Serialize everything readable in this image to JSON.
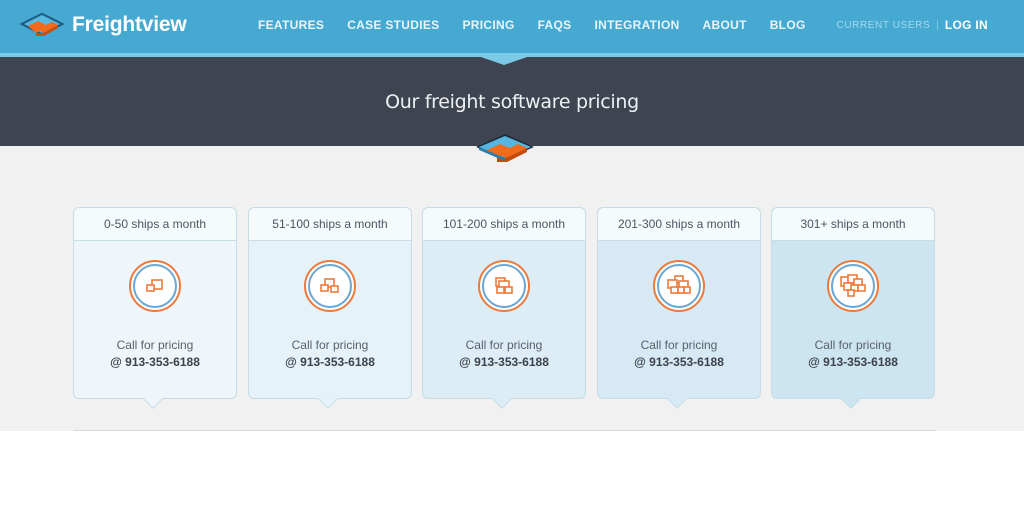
{
  "header": {
    "brand": "Freightview",
    "nav": [
      "FEATURES",
      "CASE STUDIES",
      "PRICING",
      "FAQS",
      "INTEGRATION",
      "ABOUT",
      "BLOG"
    ],
    "current_users_label": "CURRENT USERS",
    "separator": "|",
    "login_label": "LOG IN",
    "brand_color": "#45a9d1",
    "accent_orange": "#ec7a3c"
  },
  "banner": {
    "title": "Our freight software pricing",
    "background": "#3e4550"
  },
  "pricing": {
    "tiers": [
      {
        "label": "0-50 ships a month",
        "icon": "boxes-1-icon",
        "call_text": "Call for pricing",
        "phone": "@ 913-353-6188",
        "bg": "#eef6fb"
      },
      {
        "label": "51-100 ships a month",
        "icon": "boxes-2-icon",
        "call_text": "Call for pricing",
        "phone": "@ 913-353-6188",
        "bg": "#e6f2f9"
      },
      {
        "label": "101-200 ships a month",
        "icon": "boxes-3-icon",
        "call_text": "Call for pricing",
        "phone": "@ 913-353-6188",
        "bg": "#ddedf6"
      },
      {
        "label": "201-300 ships a month",
        "icon": "boxes-4-icon",
        "call_text": "Call for pricing",
        "phone": "@ 913-353-6188",
        "bg": "#d6e9f4"
      },
      {
        "label": "301+ ships a month",
        "icon": "boxes-5-icon",
        "call_text": "Call for pricing",
        "phone": "@ 913-353-6188",
        "bg": "#cde5f1"
      }
    ]
  }
}
